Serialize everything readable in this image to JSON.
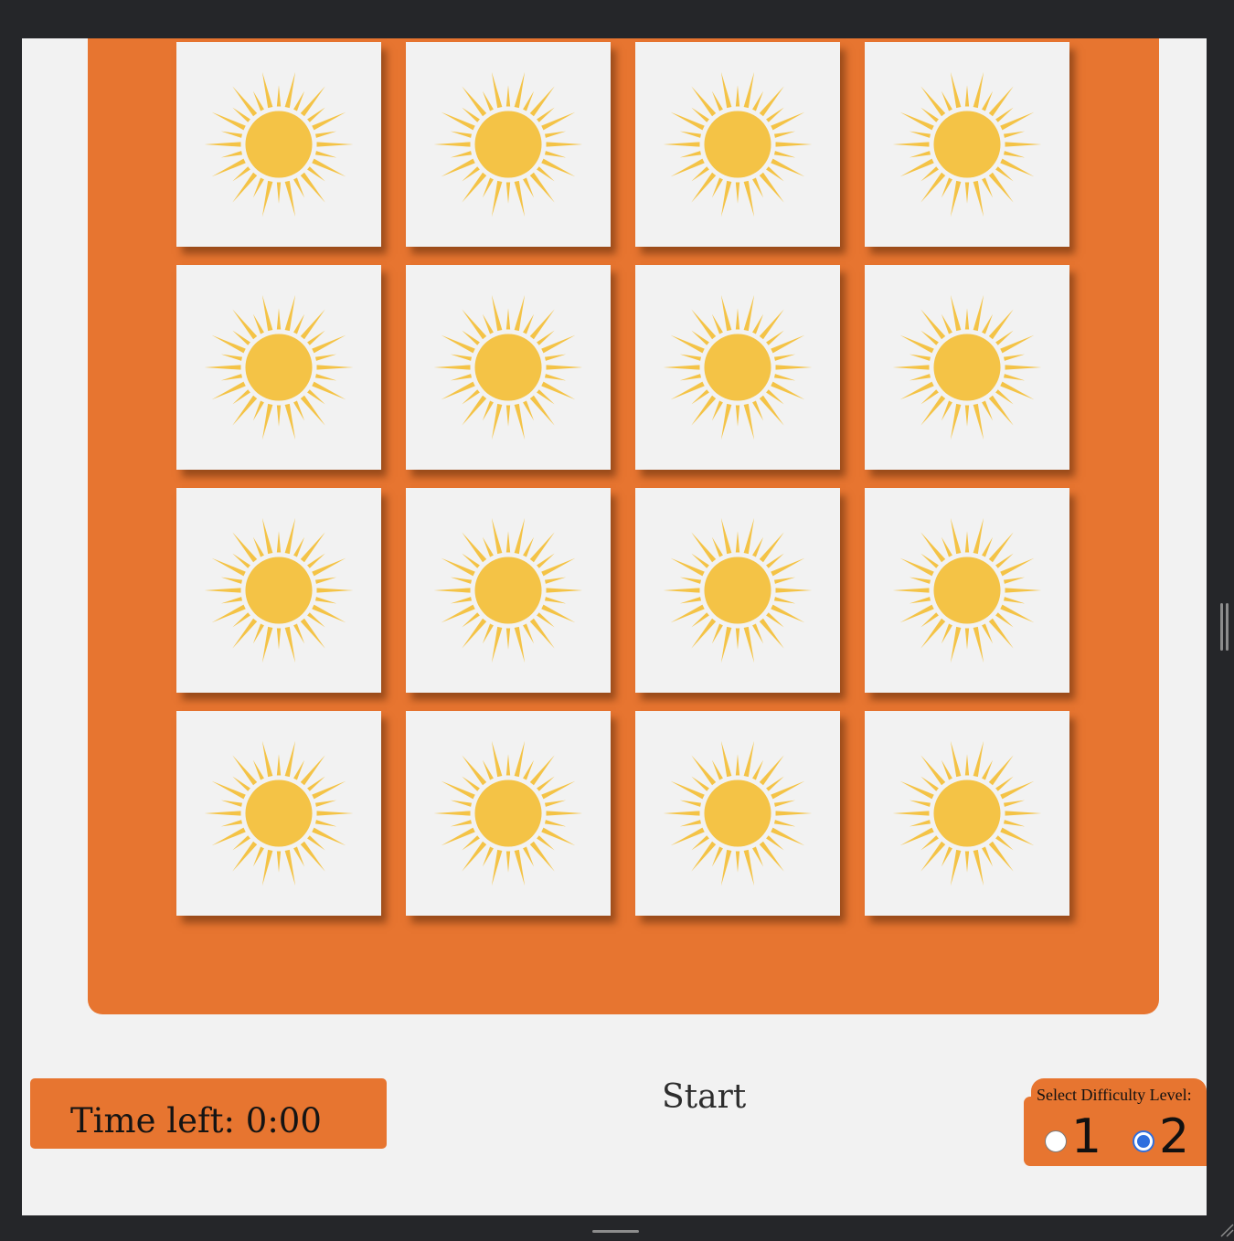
{
  "game": {
    "cards": [
      {
        "face": "sun-icon",
        "state": "face-down"
      },
      {
        "face": "sun-icon",
        "state": "face-down"
      },
      {
        "face": "sun-icon",
        "state": "face-down"
      },
      {
        "face": "sun-icon",
        "state": "face-down"
      },
      {
        "face": "sun-icon",
        "state": "face-down"
      },
      {
        "face": "sun-icon",
        "state": "face-down"
      },
      {
        "face": "sun-icon",
        "state": "face-down"
      },
      {
        "face": "sun-icon",
        "state": "face-down"
      },
      {
        "face": "sun-icon",
        "state": "face-down"
      },
      {
        "face": "sun-icon",
        "state": "face-down"
      },
      {
        "face": "sun-icon",
        "state": "face-down"
      },
      {
        "face": "sun-icon",
        "state": "face-down"
      },
      {
        "face": "sun-icon",
        "state": "face-down"
      },
      {
        "face": "sun-icon",
        "state": "face-down"
      },
      {
        "face": "sun-icon",
        "state": "face-down"
      },
      {
        "face": "sun-icon",
        "state": "face-down"
      }
    ]
  },
  "controls": {
    "timer_text": "Time left: 0:00",
    "start_label": "Start",
    "difficulty": {
      "title": "Select Difficulty Level:",
      "options": [
        "1",
        "2"
      ],
      "selected": "2"
    }
  },
  "colors": {
    "board": "#e77530",
    "card": "#f2f2f2",
    "sun": "#f4c346",
    "page": "#f2f2f2",
    "chrome": "#252629",
    "radio_selected": "#2f6fde"
  }
}
